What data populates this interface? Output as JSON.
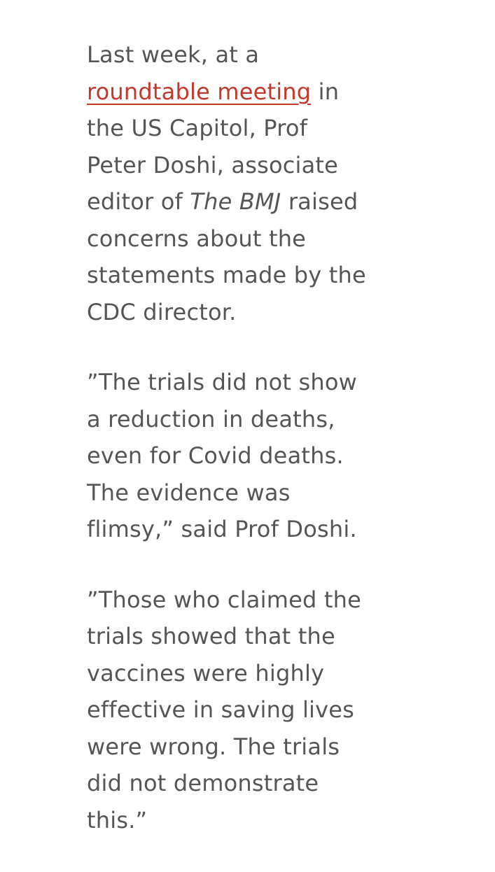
{
  "article": {
    "paragraph_1": {
      "lines": [
        "Last week, at a",
        "",
        "the US Capitol, Prof",
        "Peter Doshi, associate",
        "",
        "concerns about the",
        "statements made by the",
        "CDC director."
      ],
      "link_text": "roundtable meeting",
      "after_link": " in",
      "line5_prefix": "editor of ",
      "line5_italic": "The BMJ",
      "line5_suffix": " raised"
    },
    "paragraph_2": {
      "lines": [
        "”The trials did not show",
        "a reduction in deaths,",
        "even for Covid deaths.",
        "The evidence was",
        "flimsy,” said Prof Doshi."
      ]
    },
    "paragraph_3": {
      "lines": [
        "”Those who claimed the",
        "trials showed that the",
        "vaccines were highly",
        "effective in saving lives",
        "were wrong. The trials",
        "did not demonstrate",
        "this.”"
      ]
    }
  },
  "colors": {
    "text": "#555555",
    "link": "#c0392b",
    "background": "#ffffff"
  }
}
